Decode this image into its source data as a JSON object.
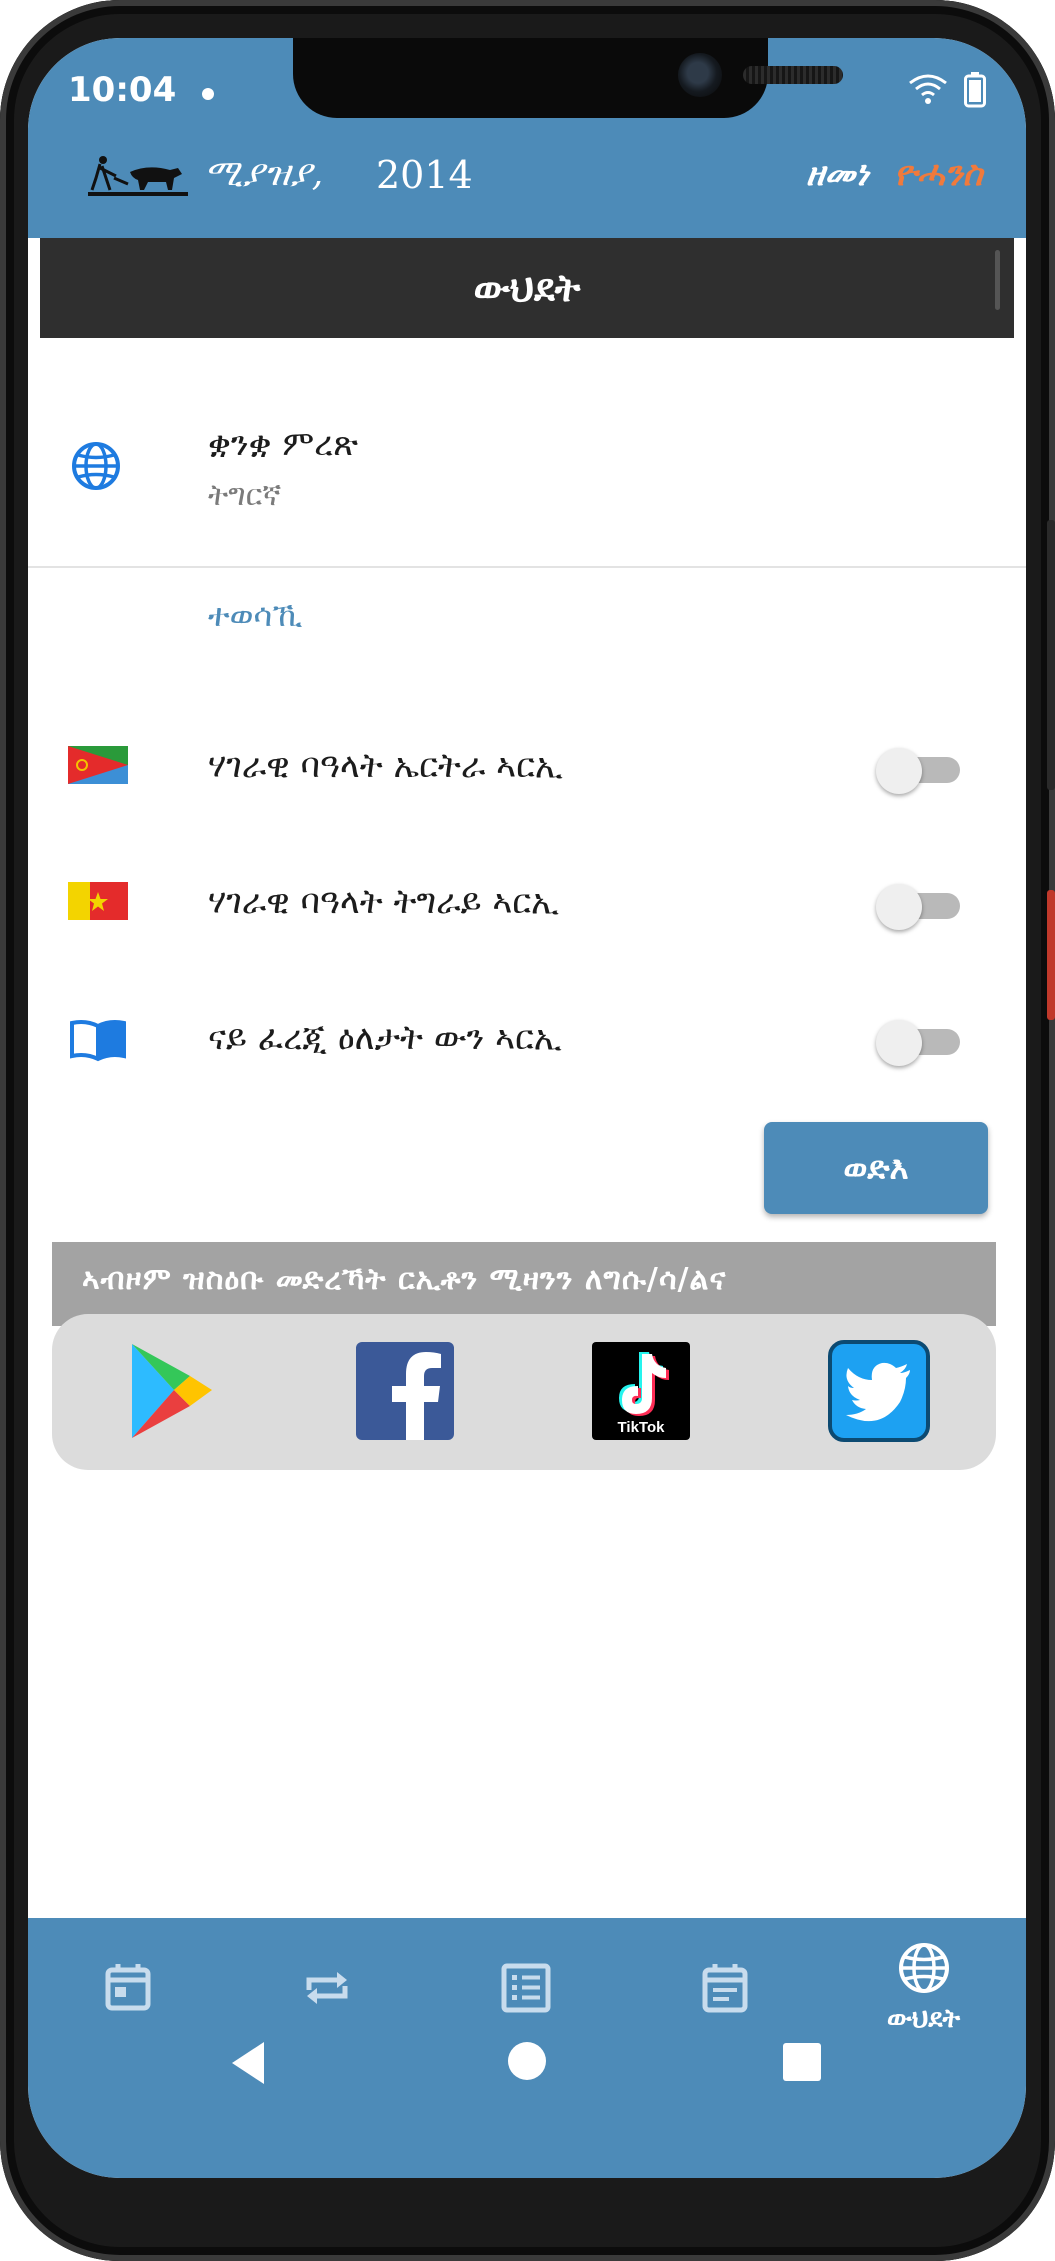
{
  "status": {
    "time": "10:04"
  },
  "header": {
    "month": "ሚያዝያ,",
    "year": "2014",
    "era_label": "ዘመነ",
    "era_name": "ዮሓንስ"
  },
  "page_title": "ውህደት",
  "language": {
    "title": "ቋንቋ ምረጽ",
    "value": "ትግርኛ"
  },
  "section": {
    "title": "ተወሳኺ"
  },
  "toggles": [
    {
      "label": "ሃገራዊ ባዓላት ኤርትራ ኣርኢ",
      "icon": "eritrea-flag-icon",
      "on": false
    },
    {
      "label": "ሃገራዊ ባዓላት ትግራይ ኣርኢ",
      "icon": "tigray-flag-icon",
      "on": false
    },
    {
      "label": "ናይ ፈረጂ ዕለታት ውን ኣርኢ",
      "icon": "book-icon",
      "on": false
    }
  ],
  "save_label": "ወድእ",
  "follow_text": "ኣብዞም ዝስዕቡ መድረኻት ርኢቶን ሚዛንን ለግሱ/ሳ/ልና",
  "social": [
    {
      "name": "google-play-icon"
    },
    {
      "name": "facebook-icon"
    },
    {
      "name": "tiktok-icon",
      "text": "TikTok"
    },
    {
      "name": "twitter-icon"
    }
  ],
  "nav": {
    "items": [
      {
        "icon": "calendar-today-icon"
      },
      {
        "icon": "repeat-icon"
      },
      {
        "icon": "list-icon"
      },
      {
        "icon": "event-note-icon"
      },
      {
        "icon": "globe-icon",
        "label": "ውህደት",
        "active": true
      }
    ]
  },
  "colors": {
    "primary": "#4d8bb8",
    "accent": "#f07a3c",
    "title_bar": "#2f2f2f"
  }
}
